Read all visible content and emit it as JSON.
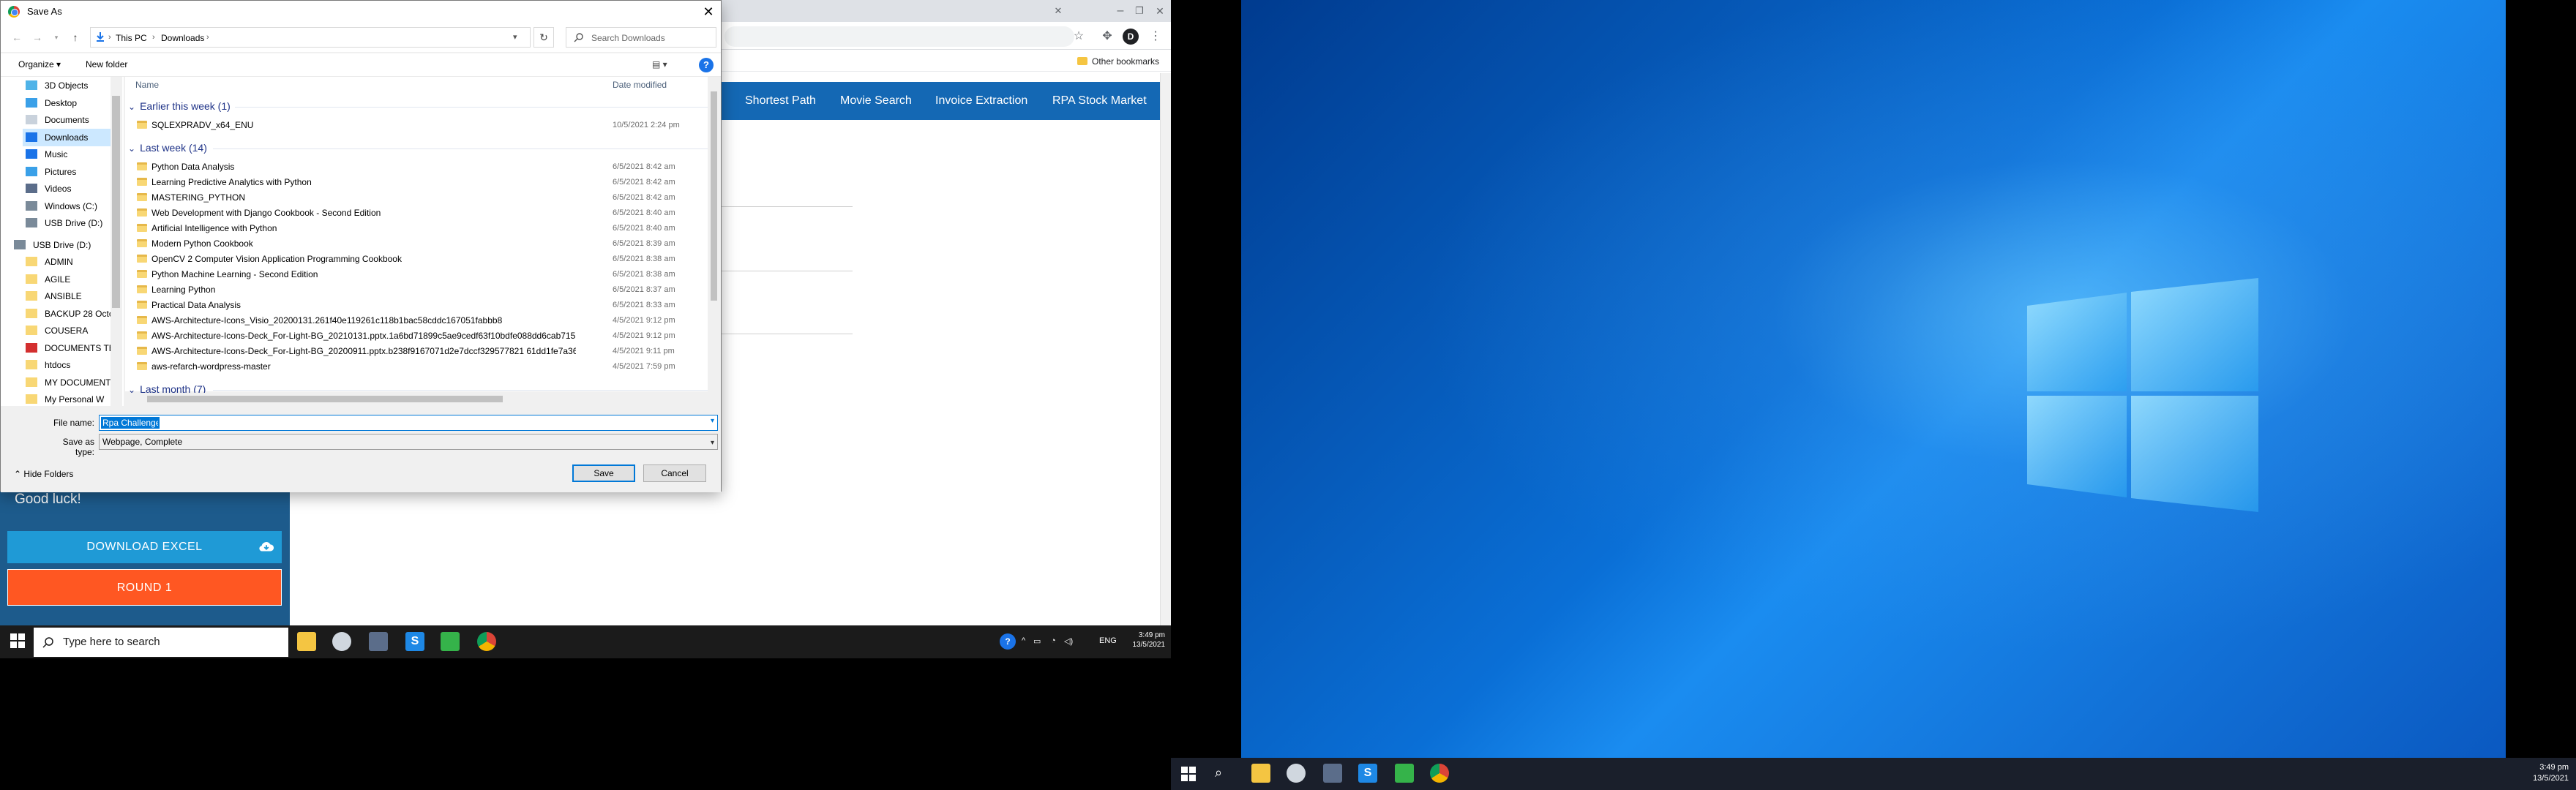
{
  "dialog": {
    "title": "Save As",
    "breadcrumb": [
      "This PC",
      "Downloads"
    ],
    "search_placeholder": "Search Downloads",
    "organize_label": "Organize ▾",
    "new_folder_label": "New folder",
    "columns": {
      "name": "Name",
      "date_modified": "Date modified"
    },
    "nav_pane": [
      {
        "label": "3D Objects",
        "icon": "cube-icon"
      },
      {
        "label": "Desktop",
        "icon": "desktop-icon"
      },
      {
        "label": "Documents",
        "icon": "documents-icon"
      },
      {
        "label": "Downloads",
        "icon": "downloads-icon",
        "selected": true
      },
      {
        "label": "Music",
        "icon": "music-icon"
      },
      {
        "label": "Pictures",
        "icon": "pictures-icon"
      },
      {
        "label": "Videos",
        "icon": "videos-icon"
      },
      {
        "label": "Windows (C:)",
        "icon": "drive-icon"
      },
      {
        "label": "USB Drive (D:)",
        "icon": "usb-drive-icon"
      },
      {
        "label": "USB Drive (D:)",
        "icon": "usb-drive-icon",
        "top_level": true
      },
      {
        "label": "ADMIN",
        "icon": "folder-icon"
      },
      {
        "label": "AGILE",
        "icon": "folder-icon"
      },
      {
        "label": "ANSIBLE",
        "icon": "folder-icon"
      },
      {
        "label": "BACKUP 28 Octo",
        "icon": "folder-icon"
      },
      {
        "label": "COUSERA",
        "icon": "folder-icon"
      },
      {
        "label": "DOCUMENTS TE",
        "icon": "pdf-icon"
      },
      {
        "label": "htdocs",
        "icon": "folder-icon"
      },
      {
        "label": "MY DOCUMENT",
        "icon": "folder-icon"
      },
      {
        "label": "My Personal W",
        "icon": "folder-icon"
      }
    ],
    "groups": [
      {
        "label": "Earlier this week (1)",
        "files": [
          {
            "name": "SQLEXPRADV_x64_ENU",
            "date": "10/5/2021 2:24 pm"
          }
        ]
      },
      {
        "label": "Last week (14)",
        "files": [
          {
            "name": "Python Data Analysis",
            "date": "6/5/2021 8:42 am"
          },
          {
            "name": "Learning Predictive Analytics with Python",
            "date": "6/5/2021 8:42 am"
          },
          {
            "name": "MASTERING_PYTHON",
            "date": "6/5/2021 8:42 am"
          },
          {
            "name": "Web Development with Django Cookbook - Second Edition",
            "date": "6/5/2021 8:40 am"
          },
          {
            "name": "Artificial Intelligence with Python",
            "date": "6/5/2021 8:40 am"
          },
          {
            "name": "Modern Python Cookbook",
            "date": "6/5/2021 8:39 am"
          },
          {
            "name": "OpenCV 2 Computer Vision Application Programming Cookbook",
            "date": "6/5/2021 8:38 am"
          },
          {
            "name": "Python Machine Learning - Second Edition",
            "date": "6/5/2021 8:38 am"
          },
          {
            "name": "Learning Python",
            "date": "6/5/2021 8:37 am"
          },
          {
            "name": "Practical Data Analysis",
            "date": "6/5/2021 8:33 am"
          },
          {
            "name": "AWS-Architecture-Icons_Visio_20200131.261f40e119261c118b1bac58cddc167051fabbb8",
            "date": "4/5/2021 9:12 pm"
          },
          {
            "name": "AWS-Architecture-Icons-Deck_For-Light-BG_20210131.pptx.1a6bd71899c5ae9cedf63f10bdfe088dd6cab715",
            "date": "4/5/2021 9:12 pm"
          },
          {
            "name": "AWS-Architecture-Icons-Deck_For-Light-BG_20200911.pptx.b238f9167071d2e7dccf329577821 61dd1fe7a36",
            "date": "4/5/2021 9:11 pm"
          },
          {
            "name": "aws-refarch-wordpress-master",
            "date": "4/5/2021 7:59 pm"
          }
        ]
      },
      {
        "label": "Last month (7)",
        "files": []
      }
    ],
    "file_name_label": "File name:",
    "file_name_value": "Rpa Challenge",
    "save_type_label": "Save as type:",
    "save_type_value": "Webpage, Complete",
    "save_button": "Save",
    "cancel_button": "Cancel",
    "hide_folders_label": "Hide Folders"
  },
  "browser": {
    "other_bookmarks": "Other bookmarks",
    "profile_initial": "D",
    "nav": [
      "Shortest Path",
      "Movie Search",
      "Invoice Extraction",
      "RPA Stock Market"
    ]
  },
  "site": {
    "good_luck": "Good luck!",
    "download_excel": "DOWNLOAD EXCEL",
    "round": "ROUND 1"
  },
  "taskbar_left": {
    "search_placeholder": "Type here to search",
    "language": "ENG",
    "time": "3:49 pm",
    "date": "13/5/2021"
  },
  "taskbar_right": {
    "time": "3:49 pm",
    "date": "13/5/2021"
  },
  "colors": {
    "site_nav": "#1468b4",
    "download_button": "#1f9ad6",
    "round_button": "#ff5722",
    "selection": "#0078d7"
  }
}
